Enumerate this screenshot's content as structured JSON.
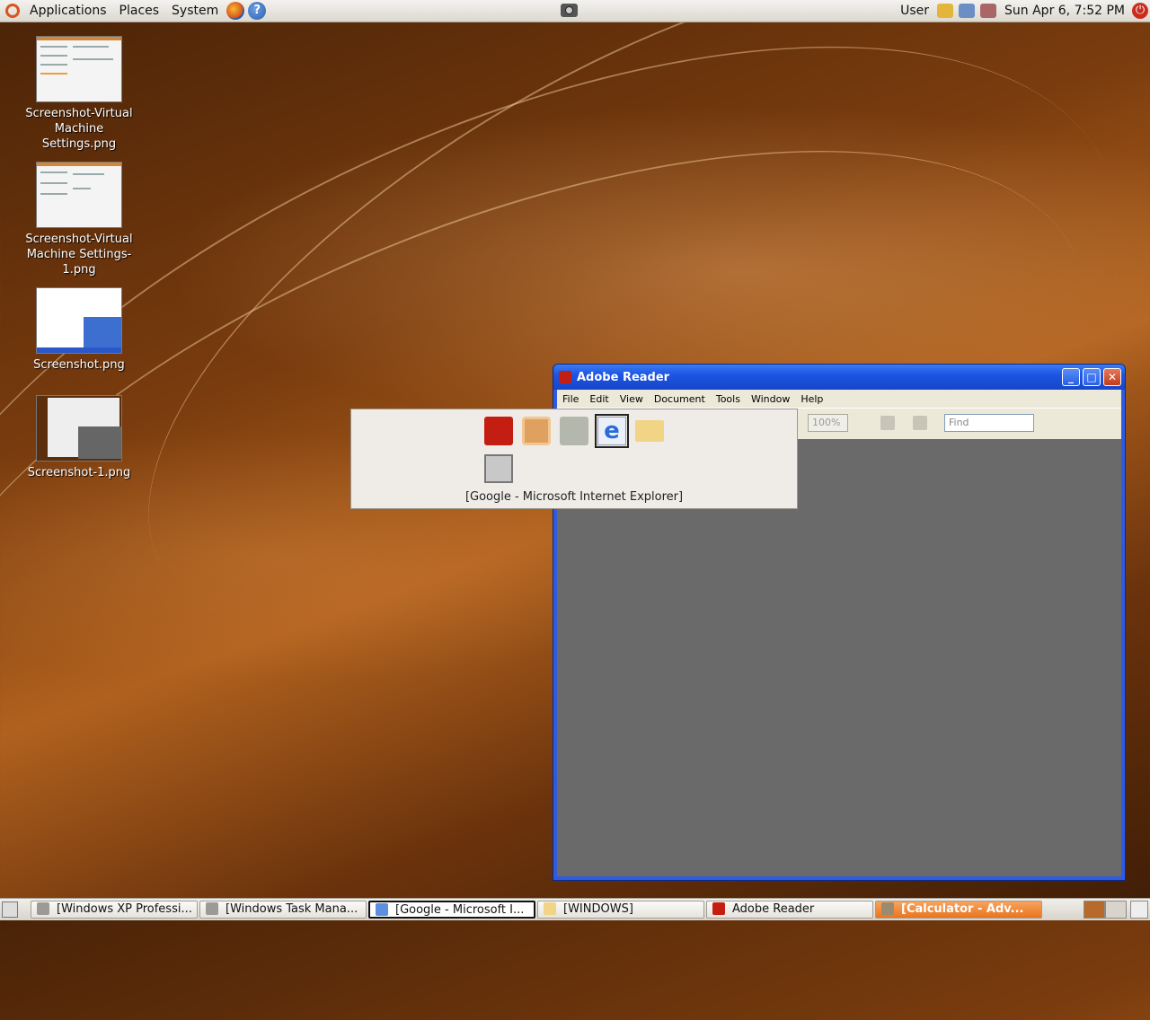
{
  "top_panel": {
    "menus": [
      "Applications",
      "Places",
      "System"
    ],
    "user": "User",
    "clock": "Sun Apr  6,  7:52 PM"
  },
  "desktop_icons": [
    {
      "label": "Screenshot-Virtual Machine Settings.png"
    },
    {
      "label": "Screenshot-Virtual Machine Settings-1.png"
    },
    {
      "label": "Screenshot.png"
    },
    {
      "label": "Screenshot-1.png"
    }
  ],
  "adobe_window": {
    "title": "Adobe Reader",
    "menu": [
      "File",
      "Edit",
      "View",
      "Document",
      "Tools",
      "Window",
      "Help"
    ],
    "zoom": "100%",
    "find_placeholder": "Find"
  },
  "switcher": {
    "caption": "[Google - Microsoft Internet Explorer]",
    "icons": [
      "adobe-reader-icon",
      "vmware-icon",
      "calculator-icon",
      "internet-explorer-icon",
      "folder-icon",
      "task-manager-icon"
    ]
  },
  "taskbar": {
    "tasks": [
      {
        "label": "[Windows XP Professi...",
        "icon": "vmware-icon"
      },
      {
        "label": "[Windows Task Mana...",
        "icon": "task-manager-icon"
      },
      {
        "label": "[Google - Microsoft I...",
        "icon": "internet-explorer-icon"
      },
      {
        "label": "[WINDOWS]",
        "icon": "folder-icon"
      },
      {
        "label": "Adobe Reader",
        "icon": "adobe-reader-icon"
      },
      {
        "label": "[Calculator  - Adv...",
        "icon": "calculator-icon"
      }
    ]
  },
  "colors": {
    "accent_orange": "#e9751f",
    "xp_blue": "#2f5be0"
  }
}
